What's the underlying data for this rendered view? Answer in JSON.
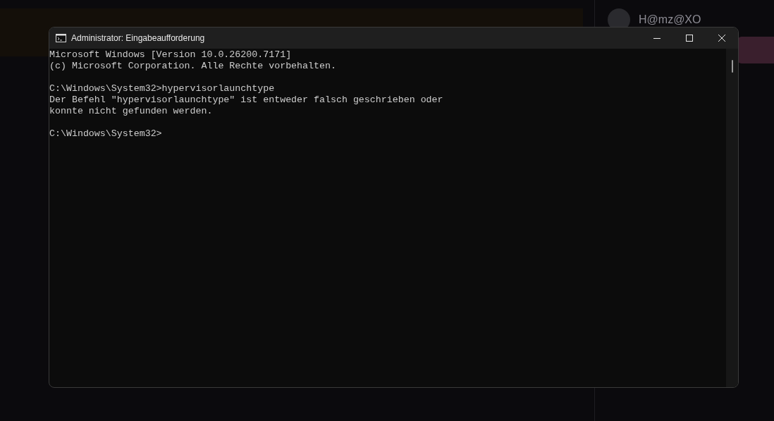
{
  "sidebar": {
    "user": {
      "name": "H@mz@XO"
    }
  },
  "window": {
    "title": "Administrator: Eingabeaufforderung"
  },
  "console": {
    "blocks": [
      {
        "lines": [
          "Microsoft Windows [Version 10.0.26200.7171]",
          "(c) Microsoft Corporation. Alle Rechte vorbehalten."
        ]
      },
      {
        "lines": [
          "C:\\Windows\\System32>hypervisorlaunchtype",
          "Der Befehl \"hypervisorlaunchtype\" ist entweder falsch geschrieben oder",
          "konnte nicht gefunden werden."
        ]
      },
      {
        "lines": [
          "C:\\Windows\\System32>"
        ]
      }
    ]
  }
}
